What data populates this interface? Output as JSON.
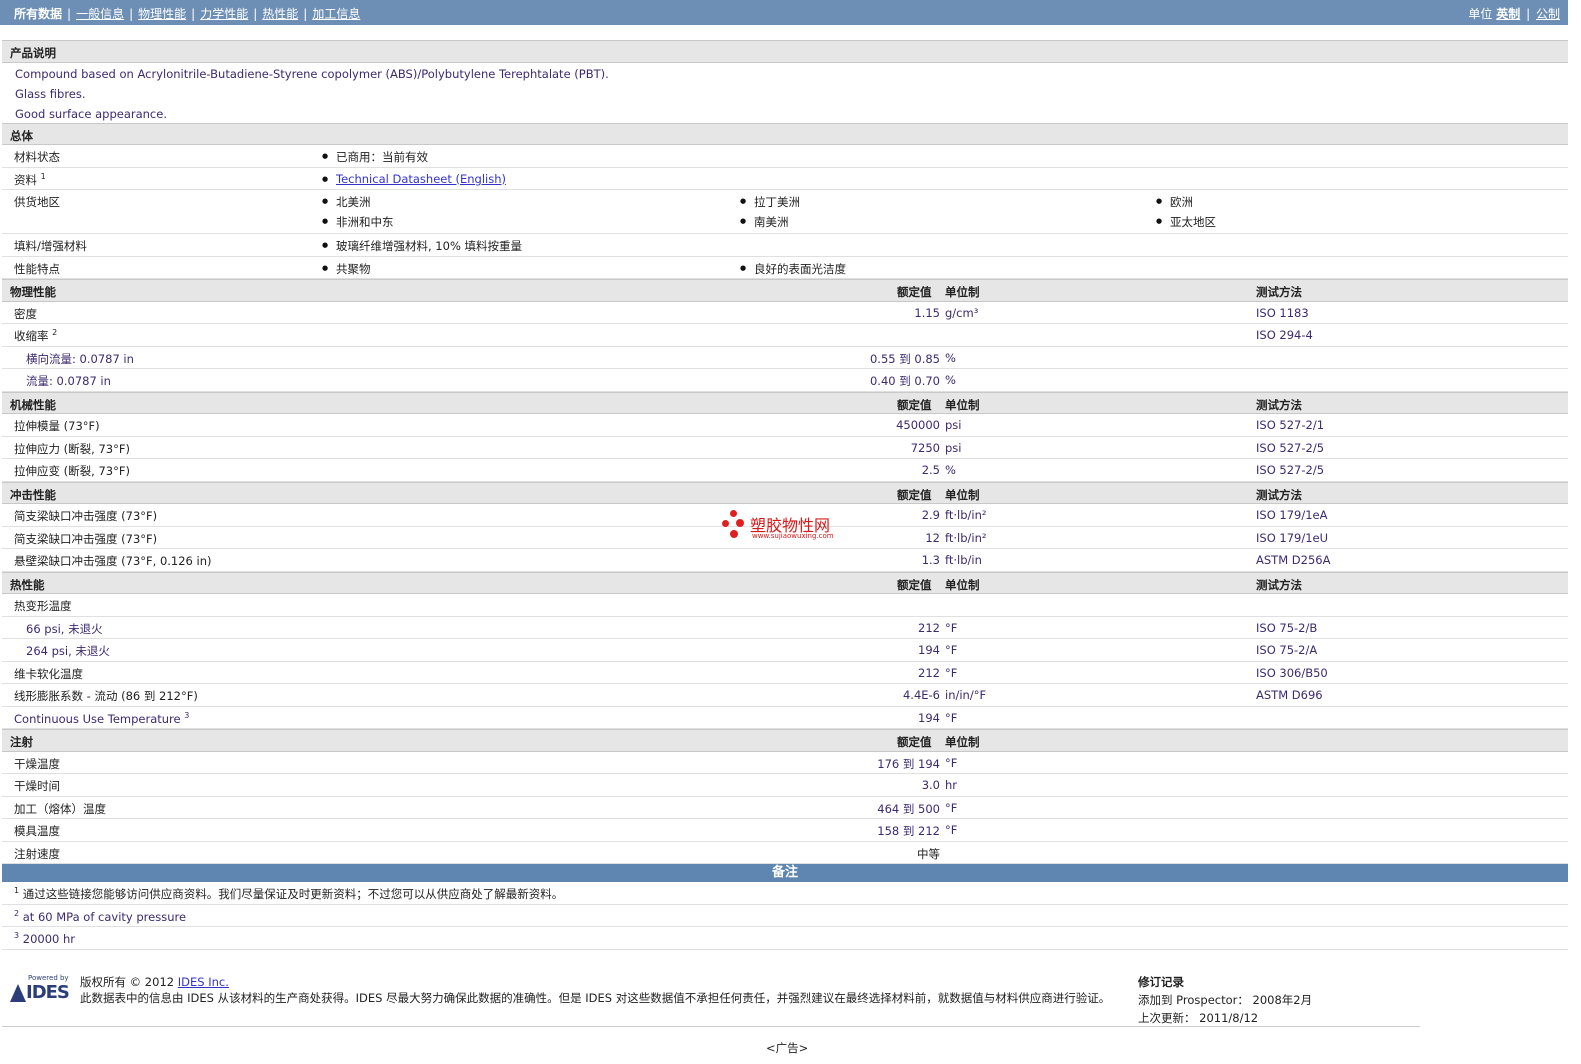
{
  "nav": {
    "items": [
      "所有数据",
      "一般信息",
      "物理性能",
      "力学性能",
      "热性能",
      "加工信息"
    ],
    "units_label": "单位",
    "unit_options": [
      "英制",
      "公制"
    ]
  },
  "description": {
    "header": "产品说明",
    "lines": [
      "Compound based on Acrylonitrile-Butadiene-Styrene copolymer (ABS)/Polybutylene Terephtalate (PBT).",
      "Glass fibres.",
      "Good surface appearance."
    ]
  },
  "general": {
    "header": "总体",
    "material_status": {
      "label": "材料状态",
      "value": "已商用：当前有效"
    },
    "literature": {
      "label": "资料",
      "sup": "1",
      "value": "Technical Datasheet (English)"
    },
    "availability": {
      "label": "供货地区",
      "values": [
        "北美洲",
        "拉丁美洲",
        "欧洲",
        "非洲和中东",
        "南美洲",
        "亚太地区"
      ]
    },
    "filler": {
      "label": "填料/增强材料",
      "value": "玻璃纤维增强材料, 10% 填料按重量"
    },
    "features": {
      "label": "性能特点",
      "values": [
        "共聚物",
        "良好的表面光洁度"
      ]
    }
  },
  "col_headers": {
    "nominal": "额定值",
    "unit": "单位制",
    "test": "测试方法"
  },
  "physical": {
    "header": "物理性能",
    "density": {
      "label": "密度",
      "value": "1.15",
      "unit": "g/cm³",
      "test": "ISO 1183"
    },
    "shrinkage": {
      "label": "收缩率",
      "sup": "2",
      "test": "ISO 294-4"
    },
    "shrink_cross": {
      "label": "横向流量: 0.0787 in",
      "value": "0.55 到  0.85",
      "unit": "%"
    },
    "shrink_flow": {
      "label": "流量: 0.0787 in",
      "value": "0.40 到  0.70",
      "unit": "%"
    }
  },
  "mechanical": {
    "header": "机械性能",
    "rows": [
      {
        "label": "拉伸模量  (73°F)",
        "value": "450000",
        "unit": "psi",
        "test": "ISO 527-2/1"
      },
      {
        "label": "拉伸应力  (断裂, 73°F)",
        "value": "7250",
        "unit": "psi",
        "test": "ISO 527-2/5"
      },
      {
        "label": "拉伸应变  (断裂, 73°F)",
        "value": "2.5",
        "unit": "%",
        "test": "ISO 527-2/5"
      }
    ]
  },
  "impact": {
    "header": "冲击性能",
    "rows": [
      {
        "label": "简支梁缺口冲击强度  (73°F)",
        "value": "2.9",
        "unit": "ft·lb/in²",
        "test": "ISO 179/1eA"
      },
      {
        "label": "简支梁缺口冲击强度  (73°F)",
        "value": "12",
        "unit": "ft·lb/in²",
        "test": "ISO 179/1eU"
      },
      {
        "label": "悬壁梁缺口冲击强度  (73°F, 0.126 in)",
        "value": "1.3",
        "unit": "ft·lb/in",
        "test": "ASTM D256A"
      }
    ]
  },
  "thermal": {
    "header": "热性能",
    "hdt_label": "热变形温度",
    "hdt_rows": [
      {
        "label": "66 psi, 未退火",
        "value": "212",
        "unit": "°F",
        "test": "ISO 75-2/B"
      },
      {
        "label": "264 psi, 未退火",
        "value": "194",
        "unit": "°F",
        "test": "ISO 75-2/A"
      }
    ],
    "vicat": {
      "label": "维卡软化温度",
      "value": "212",
      "unit": "°F",
      "test": "ISO 306/B50"
    },
    "clte": {
      "label": "线形膨胀系数  - 流动  (86 到  212°F)",
      "value": "4.4E-6",
      "unit": "in/in/°F",
      "test": "ASTM D696"
    },
    "cut": {
      "label": "Continuous Use Temperature",
      "sup": "3",
      "value": "194",
      "unit": "°F"
    }
  },
  "injection": {
    "header": "注射",
    "rows": [
      {
        "label": "干燥温度",
        "value": "176 到  194",
        "unit": "°F"
      },
      {
        "label": "干燥时间",
        "value": "3.0",
        "unit": "hr"
      },
      {
        "label": "加工（熔体）温度",
        "value": "464 到  500",
        "unit": "°F"
      },
      {
        "label": "模具温度",
        "value": "158 到  212",
        "unit": "°F"
      },
      {
        "label": "注射速度",
        "value": "中等",
        "unit": ""
      }
    ]
  },
  "notes": {
    "header": "备注",
    "items": [
      {
        "sup": "1",
        "text": "通过这些链接您能够访问供应商资料。我们尽量保证及时更新资料；不过您可以从供应商处了解最新资料。"
      },
      {
        "sup": "2",
        "text": "at 60 MPa of cavity pressure"
      },
      {
        "sup": "3",
        "text": "20000 hr"
      }
    ]
  },
  "footer": {
    "logo_powered": "Powered by",
    "logo_text": "IDES",
    "copyright_prefix": "版权所有  © 2012",
    "copyright_link": "IDES Inc.",
    "disclaimer": "此数据表中的信息由  IDES 从该材料的生产商处获得。IDES 尽最大努力确保此数据的准确性。但是  IDES 对这些数据值不承担任何责任，并强烈建议在最终选择材料前，就数据值与材料供应商进行验证。",
    "revision_header": "修订记录",
    "added": "添加到  Prospector：  2008年2月",
    "updated": "上次更新：  2011/8/12",
    "ad": "<广告>"
  },
  "watermark": {
    "text": "塑胶物性网",
    "url": "www.sujiaowuxing.com"
  }
}
